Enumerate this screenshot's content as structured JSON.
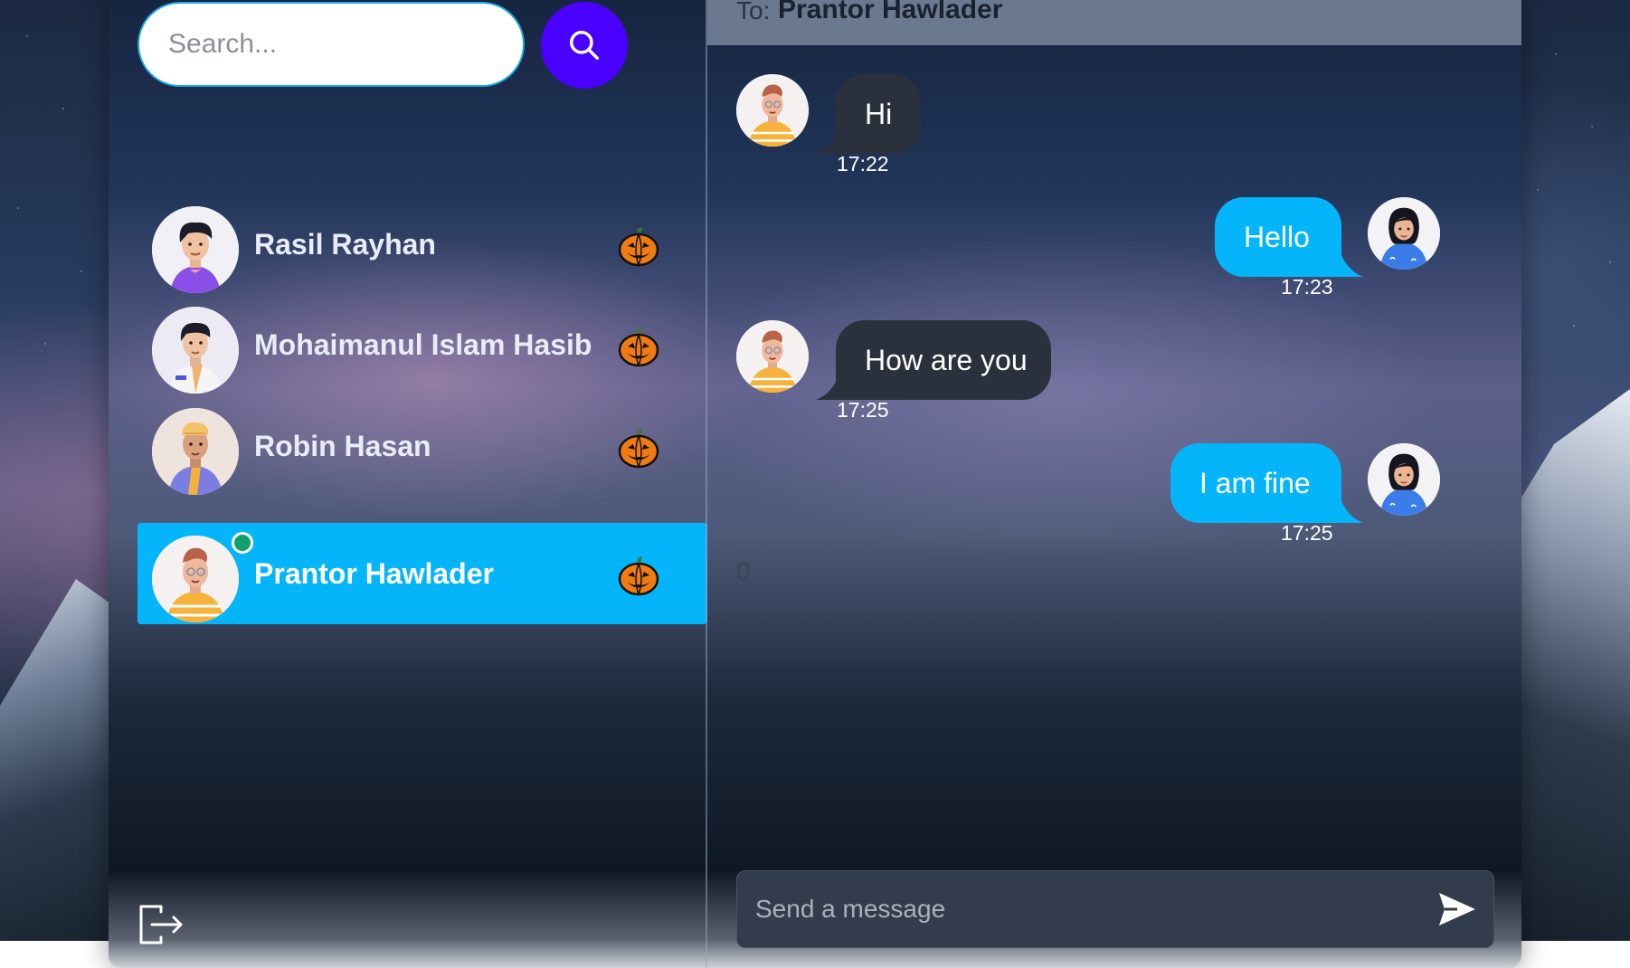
{
  "search": {
    "placeholder": "Search...",
    "button_icon": "search-icon"
  },
  "contacts": [
    {
      "name": "Rasil Rayhan",
      "badge_icon": "pumpkin-icon",
      "active": false,
      "online": false
    },
    {
      "name": "Mohaimanul Islam Hasib",
      "badge_icon": "pumpkin-icon",
      "active": false,
      "online": false
    },
    {
      "name": "Robin Hasan",
      "badge_icon": "pumpkin-icon",
      "active": false,
      "online": false
    },
    {
      "name": "Prantor Hawlader",
      "badge_icon": "pumpkin-icon",
      "active": true,
      "online": true
    }
  ],
  "logout_icon": "logout-icon",
  "chat": {
    "to_label": "To:",
    "to_name": "Prantor Hawlader",
    "messages": [
      {
        "direction": "received",
        "text": "Hi",
        "time": "17:22"
      },
      {
        "direction": "sent",
        "text": "Hello",
        "time": "17:23"
      },
      {
        "direction": "received",
        "text": "How are you",
        "time": "17:25"
      },
      {
        "direction": "sent",
        "text": "I am fine",
        "time": "17:25"
      }
    ],
    "typing_indicator": "0",
    "compose_placeholder": "Send a message",
    "send_icon": "send-icon"
  },
  "colors": {
    "accent": "#05b5fa",
    "search_button": "#4a00ff",
    "received_bubble": "#2b313c",
    "online": "#0e9f6e",
    "header": "#6a7990"
  }
}
